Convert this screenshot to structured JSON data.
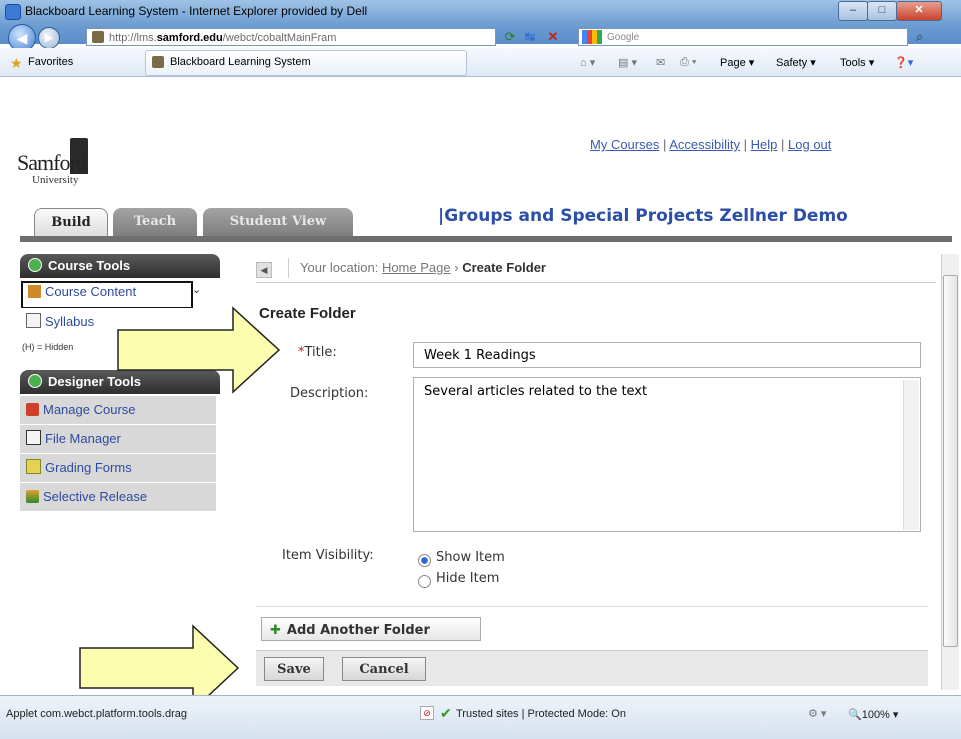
{
  "window": {
    "title": "Blackboard Learning System - Internet Explorer provided by Dell"
  },
  "addressbar": {
    "url_prefix": "http://lms.",
    "url_domain": "samford.edu",
    "url_rest": "/webct/cobaltMainFram"
  },
  "search": {
    "placeholder": "Google"
  },
  "favbar": {
    "favorites_label": "Favorites",
    "tab_label": "Blackboard Learning System"
  },
  "commandbar": {
    "page": "Page ▾",
    "safety": "Safety ▾",
    "tools": "Tools ▾"
  },
  "header": {
    "logo_main": "Samford",
    "logo_sub": "University",
    "links": [
      "My Courses",
      "Accessibility",
      "Help",
      "Log out"
    ],
    "course_title": "|Groups and Special Projects Zellner Demo",
    "tabs": [
      "Build",
      "Teach",
      "Student View"
    ]
  },
  "sidebar": {
    "course_tools_title": "Course Tools",
    "course_items": [
      "Course Content",
      "Syllabus"
    ],
    "hidden_note": "(H) = Hidden",
    "designer_tools_title": "Designer Tools",
    "designer_items": [
      "Manage Course",
      "File Manager",
      "Grading Forms",
      "Selective Release"
    ]
  },
  "breadcrumb": {
    "prefix": "Your location:",
    "home": "Home Page",
    "separator": "›",
    "current": "Create Folder"
  },
  "form": {
    "title": "Create Folder",
    "title_required": "*",
    "title_label": "Title:",
    "title_value": "Week 1 Readings",
    "description_label": "Description:",
    "description_value": "Several articles related to the text",
    "visibility_label": "Item Visibility:",
    "visibility_options": [
      "Show Item",
      "Hide Item"
    ],
    "visibility_selected": "Show Item",
    "add_folder_label": "Add Another Folder",
    "save_label": "Save",
    "cancel_label": "Cancel"
  },
  "status": {
    "text": "Applet com.webct.platform.tools.drag",
    "zone": "Trusted sites | Protected Mode: On",
    "zoom": "100%"
  },
  "colors": {
    "arrow_fill": "#fdfdb0",
    "link": "#3a5ab0",
    "course_title": "#2b4ea8"
  }
}
